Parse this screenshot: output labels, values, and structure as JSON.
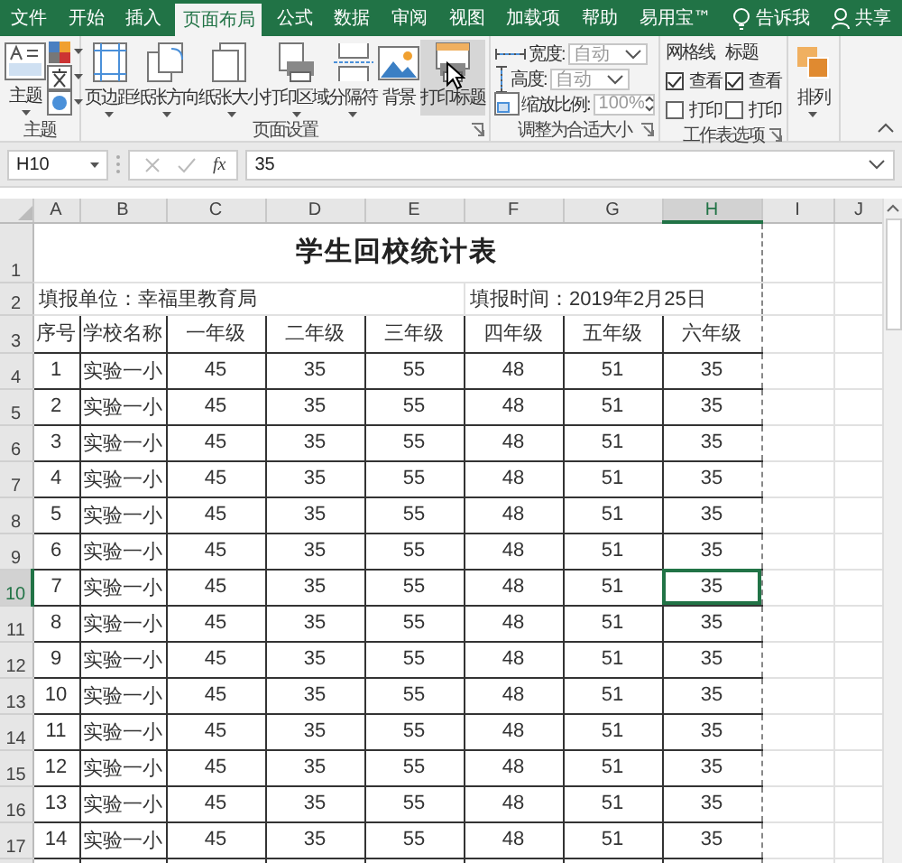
{
  "menu_tabs": [
    {
      "label": "文件",
      "selected": false
    },
    {
      "label": "开始",
      "selected": false
    },
    {
      "label": "插入",
      "selected": false
    },
    {
      "label": "页面布局",
      "selected": true
    },
    {
      "label": "公式",
      "selected": false
    },
    {
      "label": "数据",
      "selected": false
    },
    {
      "label": "审阅",
      "selected": false
    },
    {
      "label": "视图",
      "selected": false
    },
    {
      "label": "加载项",
      "selected": false
    },
    {
      "label": "帮助",
      "selected": false
    },
    {
      "label": "易用宝™",
      "selected": false
    }
  ],
  "tell_me": {
    "label": "告诉我"
  },
  "share": {
    "label": "共享"
  },
  "ribbon": {
    "groups": [
      {
        "kind": "theme",
        "label": "主题",
        "launcher": false,
        "buttons": [
          {
            "kind": "theme",
            "label": "主题",
            "dropdown": true,
            "hovered": false
          }
        ],
        "small_buttons": [
          {
            "kind": "colors"
          },
          {
            "kind": "fonts"
          },
          {
            "kind": "effects"
          }
        ]
      },
      {
        "kind": "buttons",
        "label": "页面设置",
        "launcher": true,
        "buttons": [
          {
            "kind": "margins",
            "label": "页边距",
            "dropdown": true,
            "hovered": false
          },
          {
            "kind": "orientation",
            "label": "纸张方向",
            "dropdown": true,
            "hovered": false
          },
          {
            "kind": "size",
            "label": "纸张大小",
            "dropdown": true,
            "hovered": false
          },
          {
            "kind": "print_area",
            "label": "打印区域",
            "dropdown": true,
            "hovered": false
          },
          {
            "kind": "breaks",
            "label": "分隔符",
            "dropdown": true,
            "hovered": false
          },
          {
            "kind": "background",
            "label": "背景",
            "dropdown": false,
            "hovered": false
          },
          {
            "kind": "print_titles",
            "label": "打印标题",
            "dropdown": false,
            "hovered": true
          }
        ]
      },
      {
        "kind": "scale",
        "label": "调整为合适大小",
        "launcher": true,
        "fields": [
          {
            "kind": "width",
            "label": "宽度:",
            "value": "自动"
          },
          {
            "kind": "height",
            "label": "高度:",
            "value": "自动"
          },
          {
            "kind": "scale",
            "label": "缩放比例:",
            "value": "100%"
          }
        ]
      },
      {
        "kind": "options",
        "label": "工作表选项",
        "launcher": true,
        "columns": [
          {
            "heading": "网格线",
            "options": [
              {
                "label": "查看",
                "checked": true
              },
              {
                "label": "打印",
                "checked": false
              }
            ]
          },
          {
            "heading": "标题",
            "options": [
              {
                "label": "查看",
                "checked": true
              },
              {
                "label": "打印",
                "checked": false
              }
            ]
          }
        ]
      },
      {
        "kind": "buttons",
        "launcher": false,
        "buttons": [
          {
            "kind": "arrange",
            "label": "排列",
            "dropdown": true,
            "hovered": false
          }
        ]
      }
    ]
  },
  "formula_bar": {
    "name_box": "H10",
    "function_label": "fx",
    "formula": "35"
  },
  "sheet": {
    "columns": [
      {
        "label": "A",
        "selected": false
      },
      {
        "label": "B",
        "selected": false
      },
      {
        "label": "C",
        "selected": false
      },
      {
        "label": "D",
        "selected": false
      },
      {
        "label": "E",
        "selected": false
      },
      {
        "label": "F",
        "selected": false
      },
      {
        "label": "G",
        "selected": false
      },
      {
        "label": "H",
        "selected": true
      },
      {
        "label": "I",
        "selected": false
      },
      {
        "label": "J",
        "selected": false
      }
    ],
    "row_headers": [
      {
        "label": "1",
        "selected": false
      },
      {
        "label": "2",
        "selected": false
      },
      {
        "label": "3",
        "selected": false
      },
      {
        "label": "4",
        "selected": false
      },
      {
        "label": "5",
        "selected": false
      },
      {
        "label": "6",
        "selected": false
      },
      {
        "label": "7",
        "selected": false
      },
      {
        "label": "8",
        "selected": false
      },
      {
        "label": "9",
        "selected": false
      },
      {
        "label": "10",
        "selected": true
      },
      {
        "label": "11",
        "selected": false
      },
      {
        "label": "12",
        "selected": false
      },
      {
        "label": "13",
        "selected": false
      },
      {
        "label": "14",
        "selected": false
      },
      {
        "label": "15",
        "selected": false
      },
      {
        "label": "16",
        "selected": false
      },
      {
        "label": "17",
        "selected": false
      }
    ],
    "title": "学生回校统计表",
    "unit": "填报单位：幸福里教育局",
    "date": "填报时间：2019年2月25日",
    "header": [
      "序号",
      "学校名称",
      "一年级",
      "二年级",
      "三年级",
      "四年级",
      "五年级",
      "六年级"
    ],
    "rows": [
      [
        "1",
        "实验一小",
        "45",
        "35",
        "55",
        "48",
        "51",
        "35"
      ],
      [
        "2",
        "实验一小",
        "45",
        "35",
        "55",
        "48",
        "51",
        "35"
      ],
      [
        "3",
        "实验一小",
        "45",
        "35",
        "55",
        "48",
        "51",
        "35"
      ],
      [
        "4",
        "实验一小",
        "45",
        "35",
        "55",
        "48",
        "51",
        "35"
      ],
      [
        "5",
        "实验一小",
        "45",
        "35",
        "55",
        "48",
        "51",
        "35"
      ],
      [
        "6",
        "实验一小",
        "45",
        "35",
        "55",
        "48",
        "51",
        "35"
      ],
      [
        "7",
        "实验一小",
        "45",
        "35",
        "55",
        "48",
        "51",
        "35"
      ],
      [
        "8",
        "实验一小",
        "45",
        "35",
        "55",
        "48",
        "51",
        "35"
      ],
      [
        "9",
        "实验一小",
        "45",
        "35",
        "55",
        "48",
        "51",
        "35"
      ],
      [
        "10",
        "实验一小",
        "45",
        "35",
        "55",
        "48",
        "51",
        "35"
      ],
      [
        "11",
        "实验一小",
        "45",
        "35",
        "55",
        "48",
        "51",
        "35"
      ],
      [
        "12",
        "实验一小",
        "45",
        "35",
        "55",
        "48",
        "51",
        "35"
      ],
      [
        "13",
        "实验一小",
        "45",
        "35",
        "55",
        "48",
        "51",
        "35"
      ],
      [
        "14",
        "实验一小",
        "45",
        "35",
        "55",
        "48",
        "51",
        "35"
      ]
    ]
  }
}
